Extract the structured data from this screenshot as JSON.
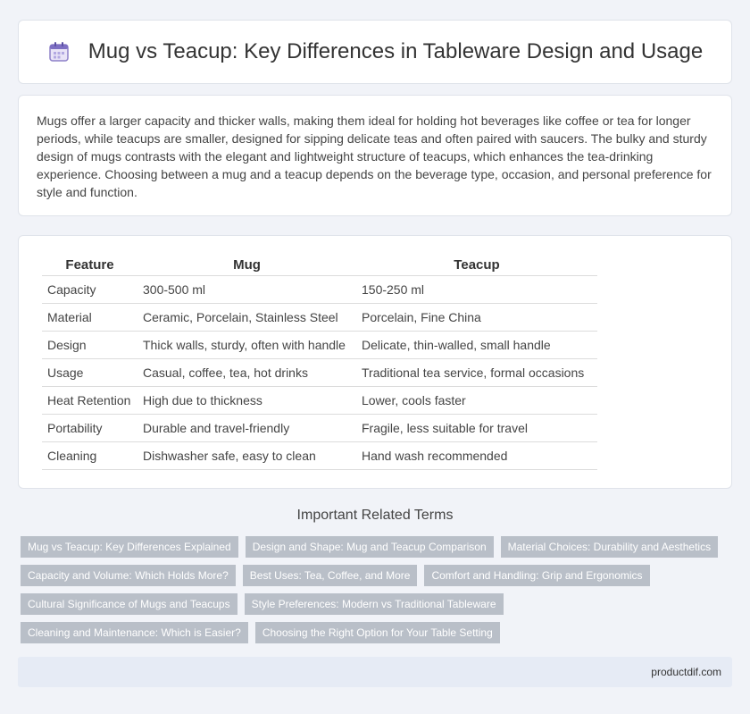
{
  "header": {
    "icon": "calendar-icon",
    "title": "Mug vs Teacup: Key Differences in Tableware Design and Usage"
  },
  "intro": "Mugs offer a larger capacity and thicker walls, making them ideal for holding hot beverages like coffee or tea for longer periods, while teacups are smaller, designed for sipping delicate teas and often paired with saucers. The bulky and sturdy design of mugs contrasts with the elegant and lightweight structure of teacups, which enhances the tea-drinking experience. Choosing between a mug and a teacup depends on the beverage type, occasion, and personal preference for style and function.",
  "table": {
    "headers": [
      "Feature",
      "Mug",
      "Teacup"
    ],
    "rows": [
      [
        "Capacity",
        "300-500 ml",
        "150-250 ml"
      ],
      [
        "Material",
        "Ceramic, Porcelain, Stainless Steel",
        "Porcelain, Fine China"
      ],
      [
        "Design",
        "Thick walls, sturdy, often with handle",
        "Delicate, thin-walled, small handle"
      ],
      [
        "Usage",
        "Casual, coffee, tea, hot drinks",
        "Traditional tea service, formal occasions"
      ],
      [
        "Heat Retention",
        "High due to thickness",
        "Lower, cools faster"
      ],
      [
        "Portability",
        "Durable and travel-friendly",
        "Fragile, less suitable for travel"
      ],
      [
        "Cleaning",
        "Dishwasher safe, easy to clean",
        "Hand wash recommended"
      ]
    ]
  },
  "related": {
    "title": "Important Related Terms",
    "tags": [
      "Mug vs Teacup: Key Differences Explained",
      "Design and Shape: Mug and Teacup Comparison",
      "Material Choices: Durability and Aesthetics",
      "Capacity and Volume: Which Holds More?",
      "Best Uses: Tea, Coffee, and More",
      "Comfort and Handling: Grip and Ergonomics",
      "Cultural Significance of Mugs and Teacups",
      "Style Preferences: Modern vs Traditional Tableware",
      "Cleaning and Maintenance: Which is Easier?",
      "Choosing the Right Option for Your Table Setting"
    ]
  },
  "footer": {
    "site": "productdif.com"
  },
  "colors": {
    "tag_bg": "#b9bfc8",
    "footer_bg": "#e6ebf5",
    "page_bg": "#f1f3f8"
  }
}
